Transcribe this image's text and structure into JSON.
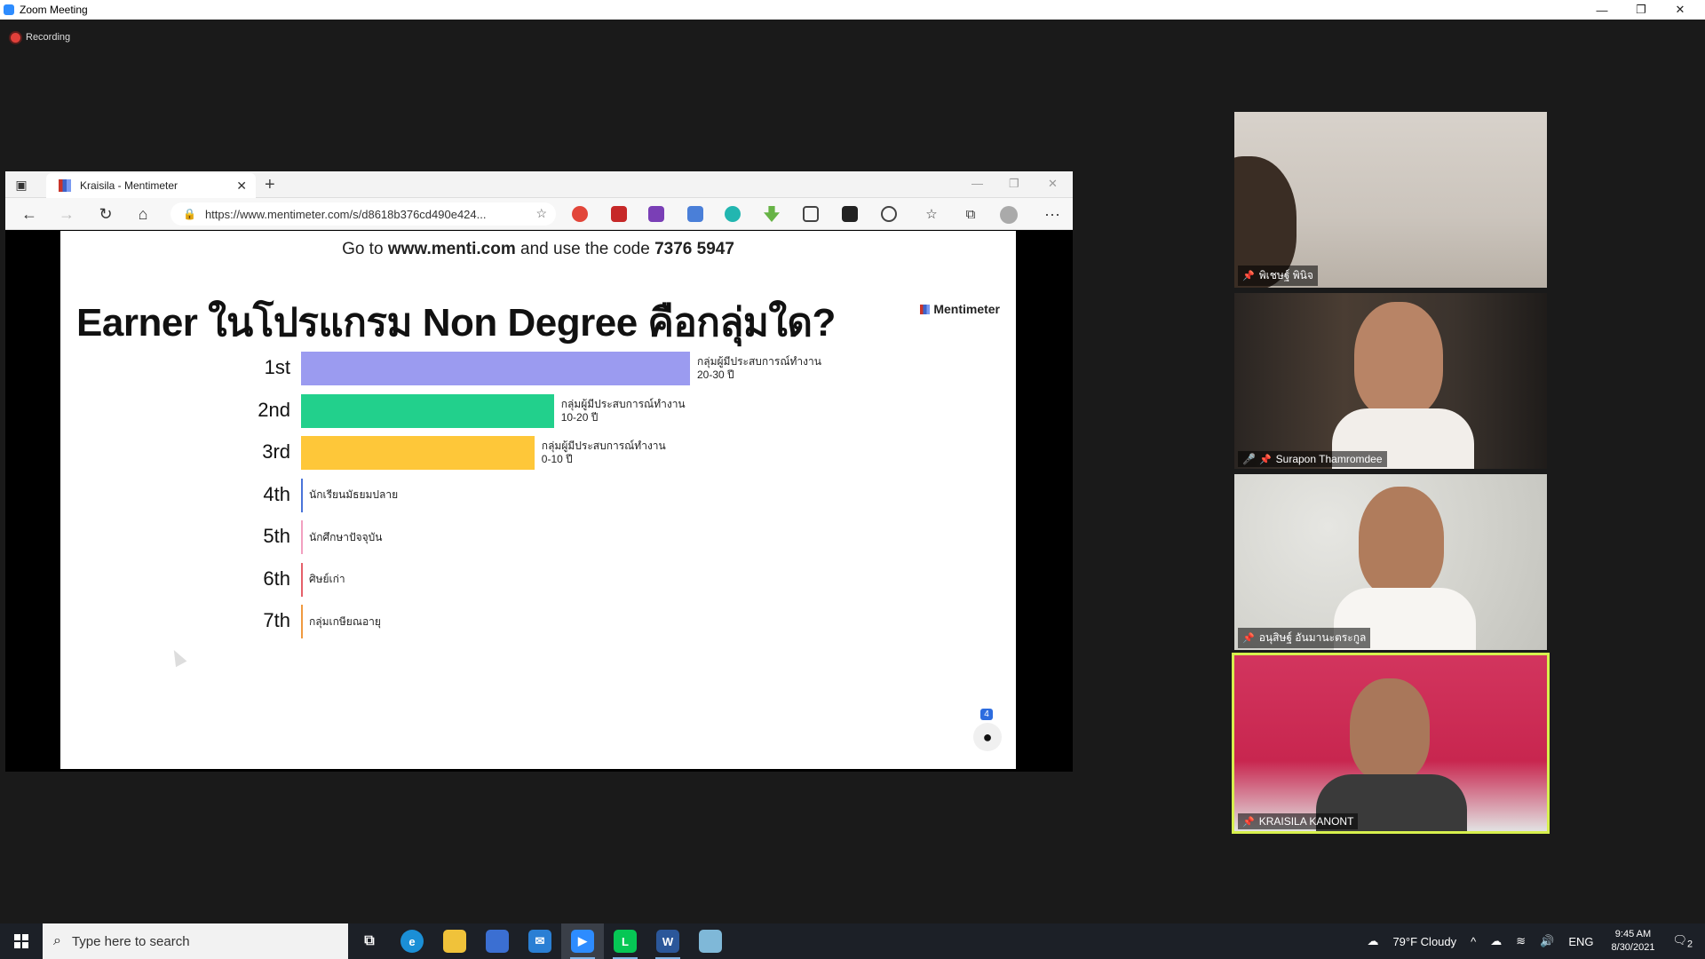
{
  "zoom": {
    "window_title": "Zoom Meeting",
    "recording_label": "Recording",
    "controls": {
      "minimize": "—",
      "restore": "❐",
      "close": "✕"
    }
  },
  "browser": {
    "tab_title": "Kraisila - Mentimeter",
    "url": "https://www.mentimeter.com/s/d8618b376cd490e424...",
    "new_tab": "+",
    "tab_close": "✕"
  },
  "slide": {
    "join_prefix": "Go to ",
    "join_site": "www.menti.com",
    "join_middle": " and use the code ",
    "join_code": "7376 5947",
    "question": "Earner ในโปรแกรม Non Degree คือกลุ่มใด?",
    "brand": "Mentimeter",
    "voter_count": "4"
  },
  "chart_data": {
    "type": "bar",
    "ranks": [
      "1st",
      "2nd",
      "3rd",
      "4th",
      "5th",
      "6th",
      "7th"
    ],
    "categories": [
      "กลุ่มผู้มีประสบการณ์ทำงาน\n20-30 ปี",
      "กลุ่มผู้มีประสบการณ์ทำงาน\n10-20 ปี",
      "กลุ่มผู้มีประสบการณ์ทำงาน\n0-10 ปี",
      "นักเรียนมัธยมปลาย",
      "นักศึกษาปัจจุบัน",
      "ศิษย์เก่า",
      "กลุ่มเกษียณอายุ"
    ],
    "values": [
      1.0,
      0.65,
      0.6,
      0,
      0,
      0,
      0
    ],
    "colors": [
      "#9b9bf0",
      "#22d08c",
      "#fec739",
      "#4a74d9",
      "#f2a0c0",
      "#e5606a",
      "#f09a40"
    ]
  },
  "participants": [
    {
      "name": "พิเชษฐ์ พินิจ",
      "muted": false
    },
    {
      "name": "Surapon Thamromdee",
      "muted": true
    },
    {
      "name": "อนุสิษฐ์ อันมานะตระกูล",
      "muted": false
    },
    {
      "name": "KRAISILA KANONT",
      "muted": false,
      "active": true
    }
  ],
  "taskbar": {
    "search_placeholder": "Type here to search",
    "weather": "79°F  Cloudy",
    "language": "ENG",
    "time": "9:45 AM",
    "date": "8/30/2021",
    "notifications": "2"
  }
}
